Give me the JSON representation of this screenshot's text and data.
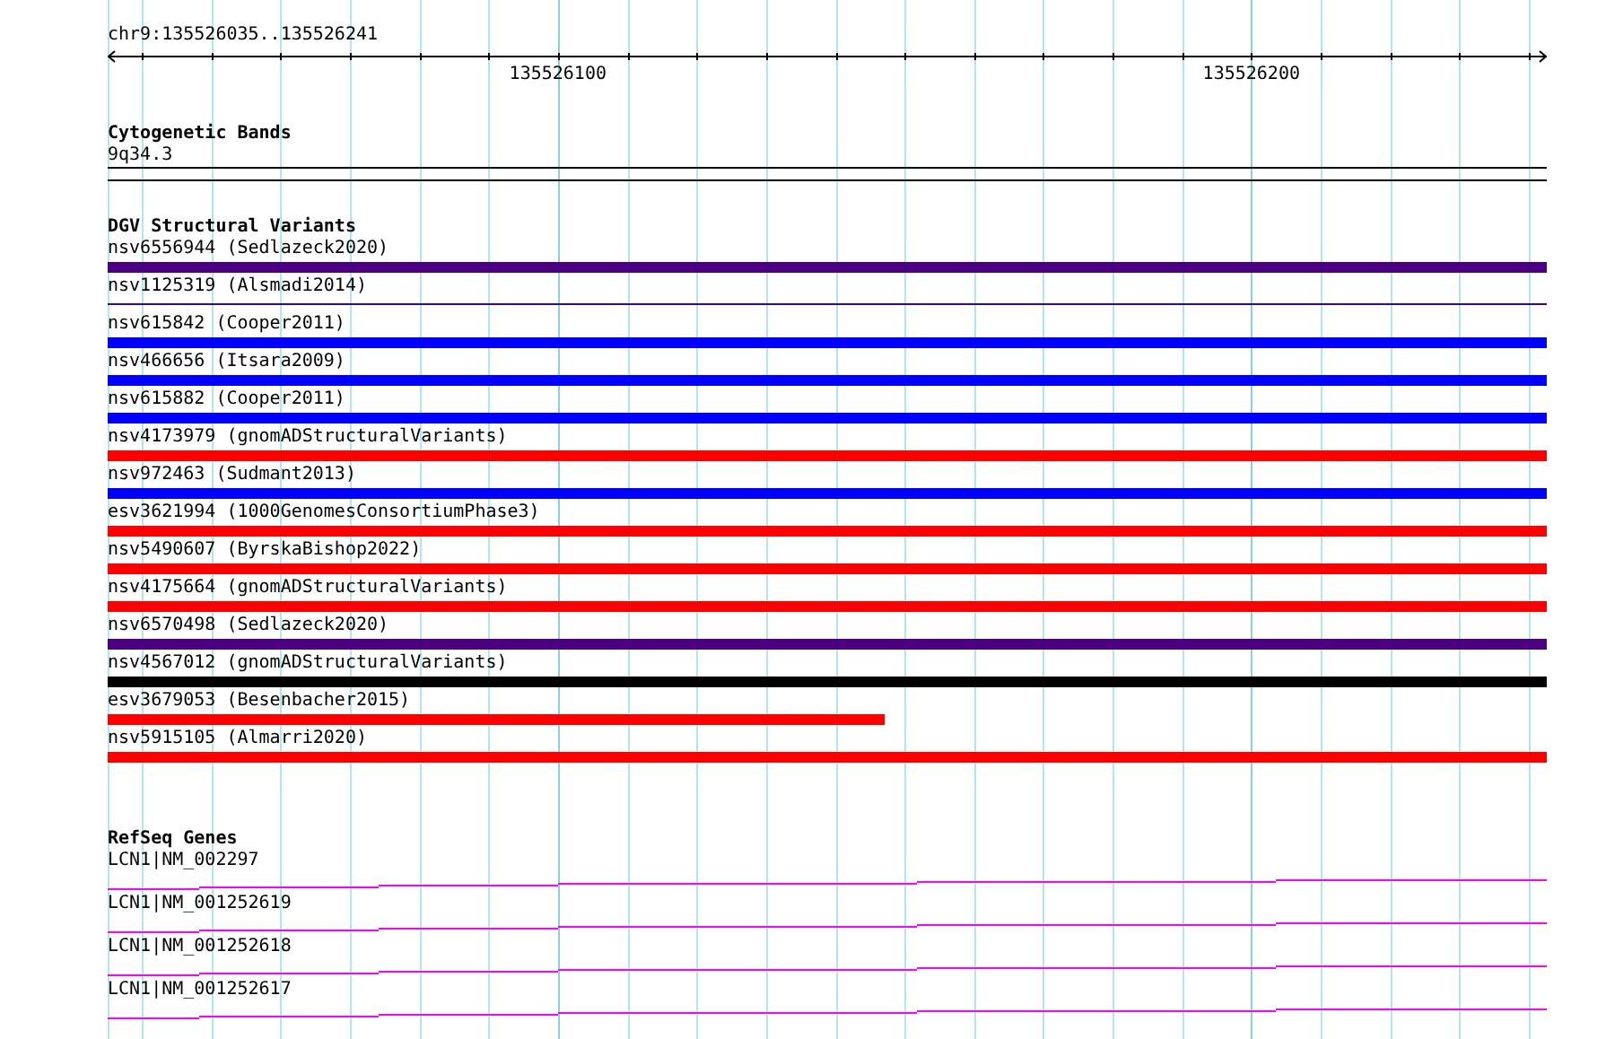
{
  "location": "chr9:135526035..135526241",
  "ruler": {
    "labels": [
      "135526100",
      "135526200"
    ]
  },
  "tracks": [
    {
      "kind": "bands",
      "title": "Cytogenetic Bands",
      "features": [
        {
          "label": "9q34.3"
        }
      ]
    },
    {
      "kind": "variants",
      "title": "DGV Structural Variants",
      "features": [
        {
          "label": "nsv6556944 (Sedlazeck2020)",
          "kind": "bar",
          "color": "#4b0082"
        },
        {
          "label": "nsv1125319 (Alsmadi2014)",
          "kind": "line",
          "color": "#4b0082"
        },
        {
          "label": "nsv615842 (Cooper2011)",
          "kind": "bar",
          "color": "#0000ff"
        },
        {
          "label": "nsv466656 (Itsara2009)",
          "kind": "bar",
          "color": "#0000ff"
        },
        {
          "label": "nsv615882 (Cooper2011)",
          "kind": "bar",
          "color": "#0000ff"
        },
        {
          "label": "nsv4173979 (gnomADStructuralVariants)",
          "kind": "bar",
          "color": "#ff0000"
        },
        {
          "label": "nsv972463 (Sudmant2013)",
          "kind": "bar",
          "color": "#0000ff"
        },
        {
          "label": "esv3621994 (1000GenomesConsortiumPhase3)",
          "kind": "bar",
          "color": "#ff0000"
        },
        {
          "label": "nsv5490607 (ByrskaBishop2022)",
          "kind": "bar",
          "color": "#ff0000"
        },
        {
          "label": "nsv4175664 (gnomADStructuralVariants)",
          "kind": "bar",
          "color": "#ff0000"
        },
        {
          "label": "nsv6570498 (Sedlazeck2020)",
          "kind": "bar",
          "color": "#4b0082"
        },
        {
          "label": "nsv4567012 (gnomADStructuralVariants)",
          "kind": "bar",
          "color": "#000000"
        },
        {
          "label": "esv3679053 (Besenbacher2015)",
          "kind": "bar",
          "color": "#ff0000",
          "level": 0.54
        },
        {
          "label": "nsv5915105 (Almarri2020)",
          "kind": "bar",
          "color": "#ff0000"
        }
      ]
    },
    {
      "kind": "genes",
      "title": "RefSeq Genes",
      "features": [
        {
          "label": "LCN1|NM_002297"
        },
        {
          "label": "LCN1|NM_001252619"
        },
        {
          "label": "LCN1|NM_001252618"
        },
        {
          "label": "LCN1|NM_001252617"
        }
      ]
    }
  ]
}
